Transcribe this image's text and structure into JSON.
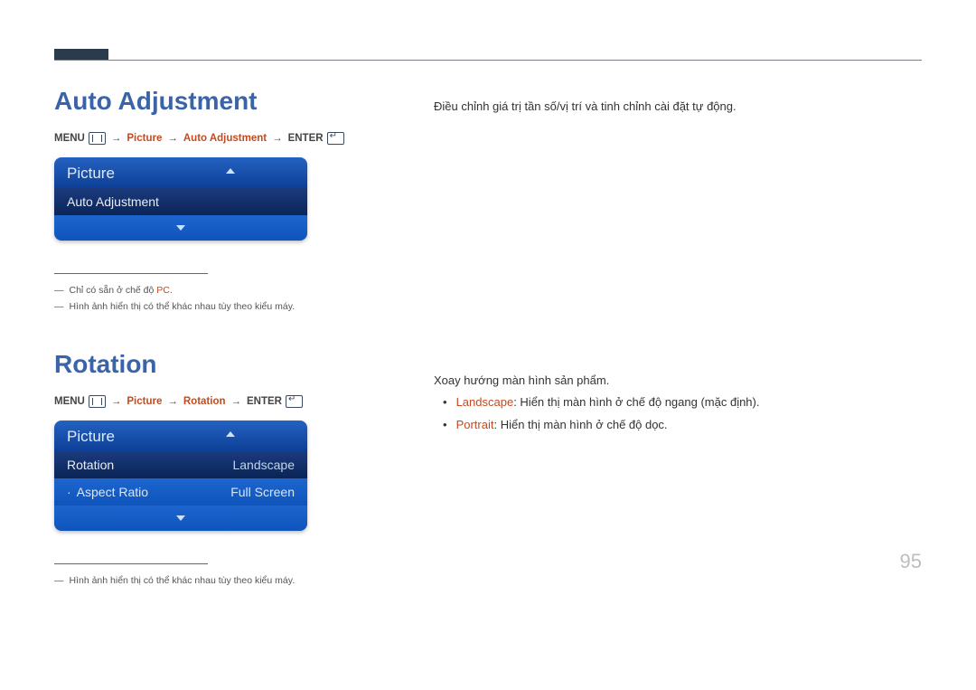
{
  "page_number": "95",
  "colors": {
    "accent": "#c64a1f",
    "heading": "#3a63a8"
  },
  "section1": {
    "title": "Auto Adjustment",
    "crumb": {
      "menu": "MENU",
      "p1": "Picture",
      "p2": "Auto Adjustment",
      "enter": "ENTER",
      "arr": "→"
    },
    "osd": {
      "header": "Picture",
      "row1_label": "Auto Adjustment"
    },
    "note1_pre": "Chỉ có sẵn ở chế độ ",
    "note1_hl": "PC",
    "note1_post": ".",
    "note2": "Hình ảnh hiển thị có thể khác nhau tùy theo kiểu máy.",
    "desc": "Điều chỉnh giá trị tần số/vị trí và tinh chỉnh cài đặt tự động."
  },
  "section2": {
    "title": "Rotation",
    "crumb": {
      "menu": "MENU",
      "p1": "Picture",
      "p2": "Rotation",
      "enter": "ENTER",
      "arr": "→"
    },
    "osd": {
      "header": "Picture",
      "row1_label": "Rotation",
      "row1_value": "Landscape",
      "row2_label": "Aspect Ratio",
      "row2_value": "Full Screen"
    },
    "note1": "Hình ảnh hiển thị có thể khác nhau tùy theo kiểu máy.",
    "desc": "Xoay hướng màn hình sản phẩm.",
    "bullet1_key": "Landscape",
    "bullet1_rest": ": Hiển thị màn hình ở chế độ ngang (mặc định).",
    "bullet2_key": "Portrait",
    "bullet2_rest": ": Hiển thị màn hình ở chế độ dọc."
  }
}
